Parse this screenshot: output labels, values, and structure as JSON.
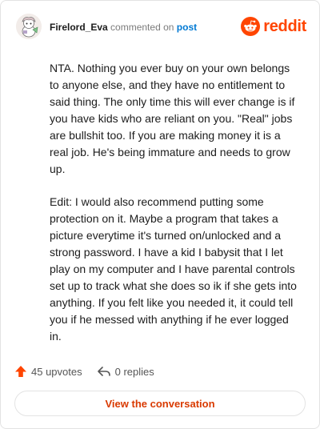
{
  "header": {
    "username": "Firelord_Eva",
    "action": "commented on",
    "post_link": "post",
    "brand": "reddit"
  },
  "comment": {
    "paragraphs": [
      "NTA. Nothing you ever buy on your own belongs to anyone else, and they have no entitlement to said thing. The only time this will ever change is if you have kids who are reliant on you. \"Real\" jobs are bullshit too. If you are making money it is a real job. He's being immature and needs to grow up.",
      "Edit: I would also recommend putting some protection on it. Maybe a program that takes a picture everytime it's turned on/unlocked and a strong password. I have a kid I babysit that I let play on my computer and I have parental controls set up to track what she does so ik if she gets into anything. If you felt like you needed it, it could tell you if he messed with anything if he ever logged in."
    ]
  },
  "footer": {
    "upvotes": "45 upvotes",
    "replies": "0 replies",
    "cta": "View the conversation"
  },
  "colors": {
    "brand": "#ff4500",
    "link": "#0079d3",
    "cta_text": "#d93a00"
  },
  "icons": {
    "brand": "reddit-logo-icon",
    "upvote": "upvote-arrow-icon",
    "reply": "reply-arrow-icon",
    "avatar": "snoo-avatar"
  }
}
